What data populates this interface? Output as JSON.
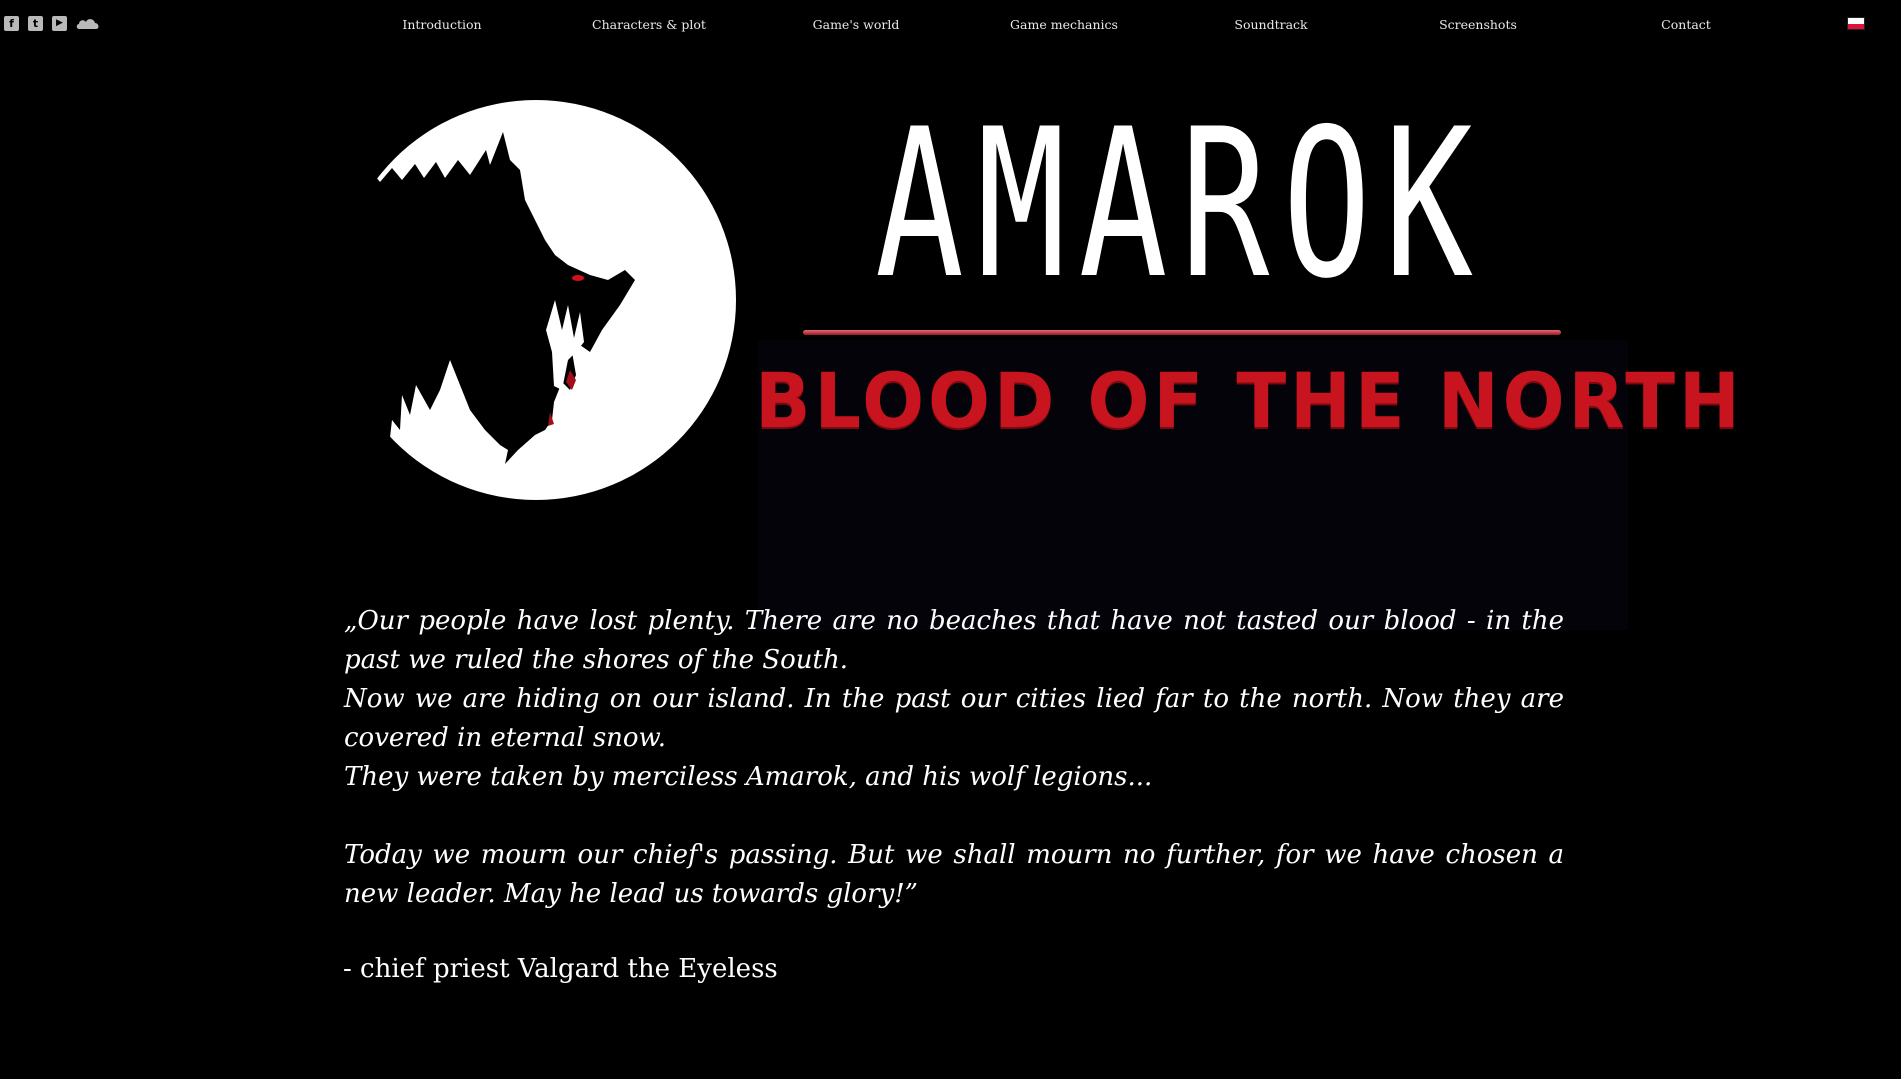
{
  "social": [
    {
      "name": "facebook-icon",
      "glyph": "f"
    },
    {
      "name": "twitter-icon",
      "glyph": "t"
    },
    {
      "name": "youtube-icon",
      "glyph": "▶"
    },
    {
      "name": "soundcloud-icon",
      "glyph": ""
    }
  ],
  "nav": {
    "items": [
      "Introduction",
      "Characters & plot",
      "Game's world",
      "Game mechanics",
      "Soundtrack",
      "Screenshots",
      "Contact"
    ]
  },
  "language_flag": {
    "colors": [
      "#ffffff",
      "#dc143c"
    ],
    "icon": "poland-flag-icon"
  },
  "logo": {
    "title": "AMAROK",
    "subtitle": "BLOOD OF THE NORTH",
    "title_color": "#ffffff",
    "subtitle_color": "#c8141f",
    "emblem": "wolf-moon-emblem"
  },
  "quote": {
    "p1": "„Our people have lost plenty. There are no beaches that have not tasted our blood - in the past we ruled the shores of the South.",
    "p2": "Now we are hiding on our island. In the past our cities lied far to the north. Now they are covered in eternal snow.",
    "p3": "They were taken by merciless Amarok, and his wolf legions...",
    "p4": "Today we mourn our chief's passing. But we shall mourn no further, for we have chosen a new leader. May he lead us towards glory!”",
    "attribution": "- chief priest Valgard the Eyeless"
  }
}
